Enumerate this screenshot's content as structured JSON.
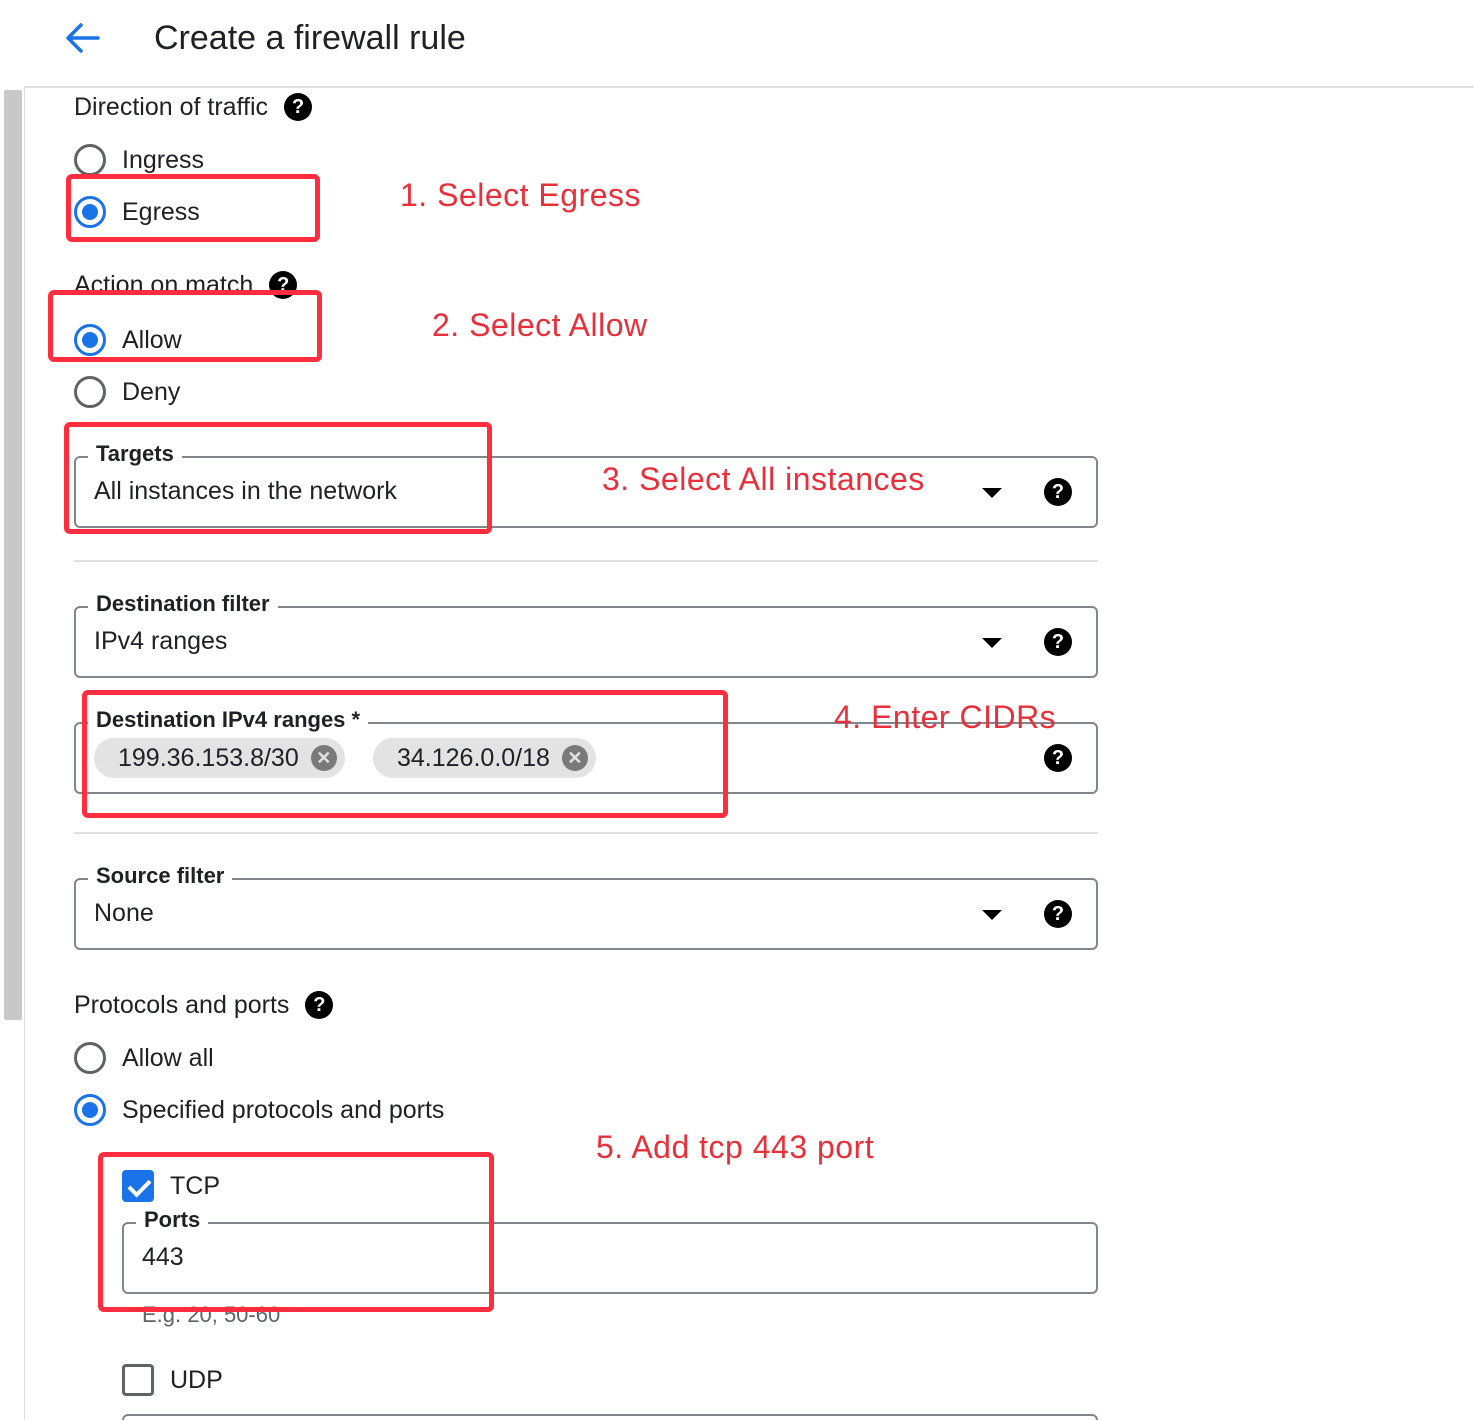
{
  "header": {
    "back_icon": "arrow-left-icon",
    "title": "Create a firewall rule"
  },
  "direction": {
    "title": "Direction of traffic",
    "help_icon": "help-icon",
    "options": [
      {
        "label": "Ingress",
        "selected": false
      },
      {
        "label": "Egress",
        "selected": true
      }
    ]
  },
  "action": {
    "title": "Action on match",
    "options": [
      {
        "label": "Allow",
        "selected": true
      },
      {
        "label": "Deny",
        "selected": false
      }
    ]
  },
  "targets": {
    "label": "Targets",
    "value": "All instances in the network"
  },
  "destination_filter": {
    "label": "Destination filter",
    "value": "IPv4 ranges"
  },
  "destination_ranges": {
    "label": "Destination IPv4 ranges *",
    "chips": [
      "199.36.153.8/30",
      "34.126.0.0/18"
    ]
  },
  "source_filter": {
    "label": "Source filter",
    "value": "None"
  },
  "protocols": {
    "title": "Protocols and ports",
    "options": [
      {
        "label": "Allow all",
        "selected": false
      },
      {
        "label": "Specified protocols and ports",
        "selected": true
      }
    ],
    "tcp": {
      "label": "TCP",
      "checked": true,
      "ports_label": "Ports",
      "ports_value": "443",
      "hint": "E.g. 20, 50-60"
    },
    "udp": {
      "label": "UDP",
      "checked": false
    }
  },
  "annotations": {
    "step1": "1. Select Egress",
    "step2": "2. Select Allow",
    "step3": "3. Select All instances",
    "step4": "4. Enter CIDRs",
    "step5": "5. Add tcp 443 port"
  },
  "colors": {
    "accent": "#1a73e8",
    "annotation": "#ff2d3d",
    "border": "#80868b"
  }
}
